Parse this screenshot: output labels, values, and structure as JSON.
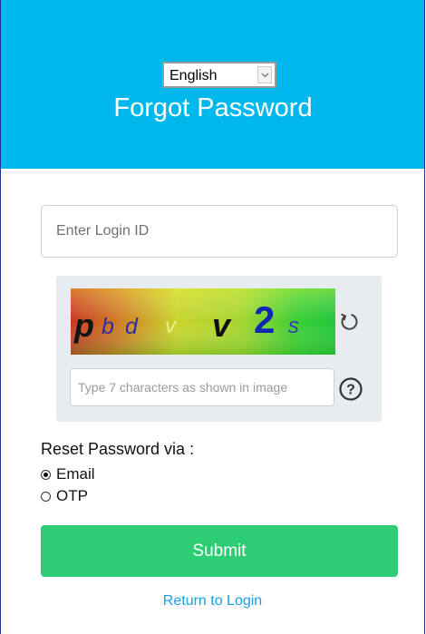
{
  "header": {
    "language_selected": "English",
    "title": "Forgot Password",
    "background_color": "#00b8eb"
  },
  "login": {
    "placeholder": "Enter Login ID"
  },
  "captcha": {
    "image_text": "pbdvv2s",
    "input_placeholder": "Type 7 characters as shown in image",
    "refresh_icon": "refresh-icon",
    "help_icon": "question-mark-icon"
  },
  "reset": {
    "label": "Reset Password via :",
    "options": [
      {
        "label": "Email",
        "checked": true
      },
      {
        "label": "OTP",
        "checked": false
      }
    ]
  },
  "actions": {
    "submit_label": "Submit",
    "submit_color": "#2ccd73",
    "return_label": "Return to Login",
    "link_color": "#1a9fe0"
  }
}
